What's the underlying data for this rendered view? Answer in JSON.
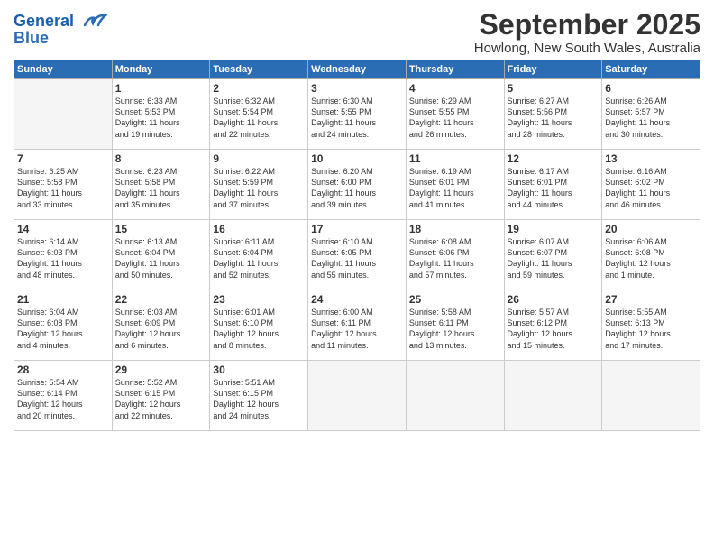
{
  "header": {
    "logo_line1": "General",
    "logo_line2": "Blue",
    "month": "September 2025",
    "location": "Howlong, New South Wales, Australia"
  },
  "weekdays": [
    "Sunday",
    "Monday",
    "Tuesday",
    "Wednesday",
    "Thursday",
    "Friday",
    "Saturday"
  ],
  "weeks": [
    [
      {
        "day": "",
        "details": ""
      },
      {
        "day": "1",
        "details": "Sunrise: 6:33 AM\nSunset: 5:53 PM\nDaylight: 11 hours\nand 19 minutes."
      },
      {
        "day": "2",
        "details": "Sunrise: 6:32 AM\nSunset: 5:54 PM\nDaylight: 11 hours\nand 22 minutes."
      },
      {
        "day": "3",
        "details": "Sunrise: 6:30 AM\nSunset: 5:55 PM\nDaylight: 11 hours\nand 24 minutes."
      },
      {
        "day": "4",
        "details": "Sunrise: 6:29 AM\nSunset: 5:55 PM\nDaylight: 11 hours\nand 26 minutes."
      },
      {
        "day": "5",
        "details": "Sunrise: 6:27 AM\nSunset: 5:56 PM\nDaylight: 11 hours\nand 28 minutes."
      },
      {
        "day": "6",
        "details": "Sunrise: 6:26 AM\nSunset: 5:57 PM\nDaylight: 11 hours\nand 30 minutes."
      }
    ],
    [
      {
        "day": "7",
        "details": "Sunrise: 6:25 AM\nSunset: 5:58 PM\nDaylight: 11 hours\nand 33 minutes."
      },
      {
        "day": "8",
        "details": "Sunrise: 6:23 AM\nSunset: 5:58 PM\nDaylight: 11 hours\nand 35 minutes."
      },
      {
        "day": "9",
        "details": "Sunrise: 6:22 AM\nSunset: 5:59 PM\nDaylight: 11 hours\nand 37 minutes."
      },
      {
        "day": "10",
        "details": "Sunrise: 6:20 AM\nSunset: 6:00 PM\nDaylight: 11 hours\nand 39 minutes."
      },
      {
        "day": "11",
        "details": "Sunrise: 6:19 AM\nSunset: 6:01 PM\nDaylight: 11 hours\nand 41 minutes."
      },
      {
        "day": "12",
        "details": "Sunrise: 6:17 AM\nSunset: 6:01 PM\nDaylight: 11 hours\nand 44 minutes."
      },
      {
        "day": "13",
        "details": "Sunrise: 6:16 AM\nSunset: 6:02 PM\nDaylight: 11 hours\nand 46 minutes."
      }
    ],
    [
      {
        "day": "14",
        "details": "Sunrise: 6:14 AM\nSunset: 6:03 PM\nDaylight: 11 hours\nand 48 minutes."
      },
      {
        "day": "15",
        "details": "Sunrise: 6:13 AM\nSunset: 6:04 PM\nDaylight: 11 hours\nand 50 minutes."
      },
      {
        "day": "16",
        "details": "Sunrise: 6:11 AM\nSunset: 6:04 PM\nDaylight: 11 hours\nand 52 minutes."
      },
      {
        "day": "17",
        "details": "Sunrise: 6:10 AM\nSunset: 6:05 PM\nDaylight: 11 hours\nand 55 minutes."
      },
      {
        "day": "18",
        "details": "Sunrise: 6:08 AM\nSunset: 6:06 PM\nDaylight: 11 hours\nand 57 minutes."
      },
      {
        "day": "19",
        "details": "Sunrise: 6:07 AM\nSunset: 6:07 PM\nDaylight: 11 hours\nand 59 minutes."
      },
      {
        "day": "20",
        "details": "Sunrise: 6:06 AM\nSunset: 6:08 PM\nDaylight: 12 hours\nand 1 minute."
      }
    ],
    [
      {
        "day": "21",
        "details": "Sunrise: 6:04 AM\nSunset: 6:08 PM\nDaylight: 12 hours\nand 4 minutes."
      },
      {
        "day": "22",
        "details": "Sunrise: 6:03 AM\nSunset: 6:09 PM\nDaylight: 12 hours\nand 6 minutes."
      },
      {
        "day": "23",
        "details": "Sunrise: 6:01 AM\nSunset: 6:10 PM\nDaylight: 12 hours\nand 8 minutes."
      },
      {
        "day": "24",
        "details": "Sunrise: 6:00 AM\nSunset: 6:11 PM\nDaylight: 12 hours\nand 11 minutes."
      },
      {
        "day": "25",
        "details": "Sunrise: 5:58 AM\nSunset: 6:11 PM\nDaylight: 12 hours\nand 13 minutes."
      },
      {
        "day": "26",
        "details": "Sunrise: 5:57 AM\nSunset: 6:12 PM\nDaylight: 12 hours\nand 15 minutes."
      },
      {
        "day": "27",
        "details": "Sunrise: 5:55 AM\nSunset: 6:13 PM\nDaylight: 12 hours\nand 17 minutes."
      }
    ],
    [
      {
        "day": "28",
        "details": "Sunrise: 5:54 AM\nSunset: 6:14 PM\nDaylight: 12 hours\nand 20 minutes."
      },
      {
        "day": "29",
        "details": "Sunrise: 5:52 AM\nSunset: 6:15 PM\nDaylight: 12 hours\nand 22 minutes."
      },
      {
        "day": "30",
        "details": "Sunrise: 5:51 AM\nSunset: 6:15 PM\nDaylight: 12 hours\nand 24 minutes."
      },
      {
        "day": "",
        "details": ""
      },
      {
        "day": "",
        "details": ""
      },
      {
        "day": "",
        "details": ""
      },
      {
        "day": "",
        "details": ""
      }
    ]
  ]
}
